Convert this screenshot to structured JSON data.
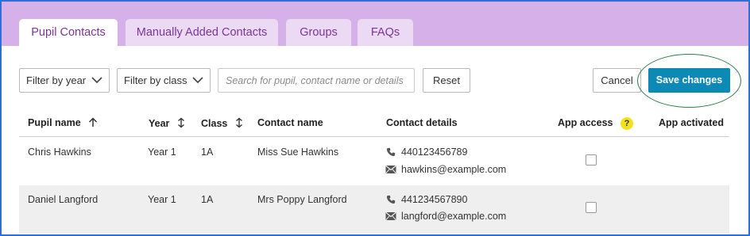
{
  "tabs": [
    {
      "label": "Pupil Contacts",
      "active": true
    },
    {
      "label": "Manually Added Contacts",
      "active": false
    },
    {
      "label": "Groups",
      "active": false
    },
    {
      "label": "FAQs",
      "active": false
    }
  ],
  "toolbar": {
    "filter_year": "Filter by year",
    "filter_class": "Filter by class",
    "search_placeholder": "Search for pupil, contact name or details",
    "reset_label": "Reset",
    "cancel_label": "Cancel",
    "save_label": "Save changes"
  },
  "table": {
    "columns": [
      {
        "label": "Pupil name",
        "icon": "sort-ascending-icon"
      },
      {
        "label": "Year",
        "icon": "sort-both-icon"
      },
      {
        "label": "Class",
        "icon": "sort-both-icon"
      },
      {
        "label": "Contact name"
      },
      {
        "label": "Contact details"
      },
      {
        "label": "App access",
        "icon": "help-icon",
        "help_glyph": "?"
      },
      {
        "label": "App activated"
      }
    ],
    "rows": [
      {
        "pupil": "Chris Hawkins",
        "year": "Year 1",
        "class": "1A",
        "contact": "Miss Sue Hawkins",
        "phone": "440123456789",
        "email": "hawkins@example.com",
        "app_access": false
      },
      {
        "pupil": "Daniel Langford",
        "year": "Year 1",
        "class": "1A",
        "contact": "Mrs Poppy Langford",
        "phone": "441234567890",
        "email": "langford@example.com",
        "app_access": false
      }
    ]
  },
  "colors": {
    "tab_bar": "#d6b0e8",
    "tab_text": "#7a3596",
    "save_button": "#0c8ab5",
    "help_badge": "#f5e11a",
    "frame_border": "#2e6fd0",
    "highlight_ring": "#2f7d4c"
  }
}
